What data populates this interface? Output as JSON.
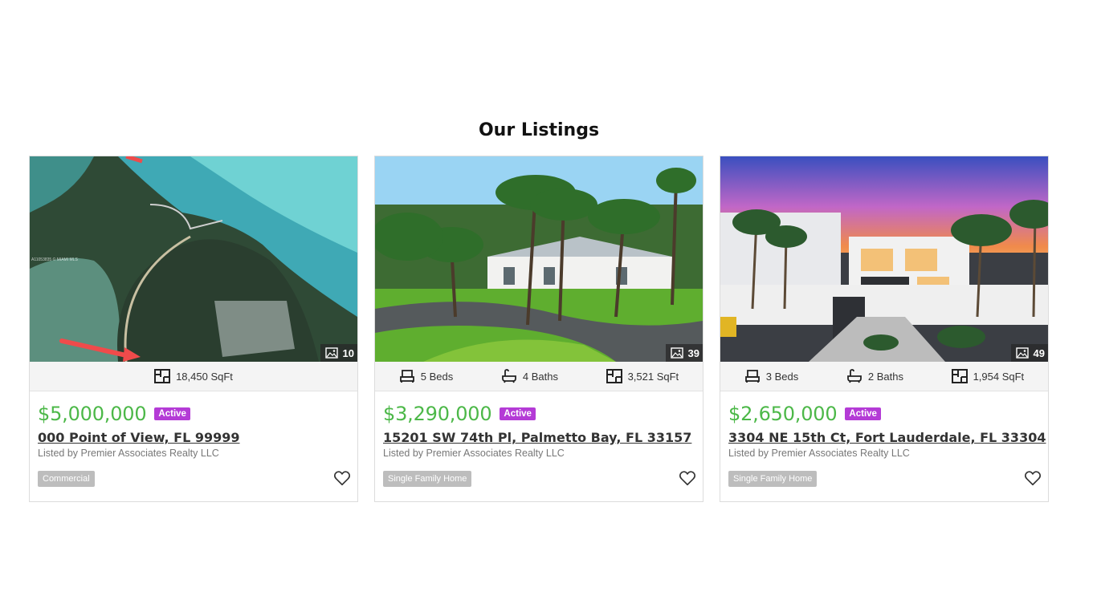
{
  "section": {
    "title": "Our Listings"
  },
  "listings": [
    {
      "photo_count": "10",
      "stats": {
        "sqft": "18,450 SqFt"
      },
      "price": "$5,000,000",
      "status": "Active",
      "address": "000 Point of View, FL 99999",
      "listed_by": "Listed by Premier Associates Realty LLC",
      "type": "Commercial",
      "image_watermark": "A11053835 © MIAMI MLS"
    },
    {
      "photo_count": "39",
      "stats": {
        "beds": "5 Beds",
        "baths": "4 Baths",
        "sqft": "3,521 SqFt"
      },
      "price": "$3,290,000",
      "status": "Active",
      "address": "15201 SW 74th Pl, Palmetto Bay, FL 33157",
      "listed_by": "Listed by Premier Associates Realty LLC",
      "type": "Single Family Home"
    },
    {
      "photo_count": "49",
      "stats": {
        "beds": "3 Beds",
        "baths": "2 Baths",
        "sqft": "1,954 SqFt"
      },
      "price": "$2,650,000",
      "status": "Active",
      "address": "3304 NE 15th Ct, Fort Lauderdale, FL 33304",
      "listed_by": "Listed by Premier Associates Realty LLC",
      "type": "Single Family Home"
    }
  ],
  "colors": {
    "price": "#4cb848",
    "status_badge": "#b43bd6",
    "type_tag": "#bdbdbd"
  },
  "icons": {
    "photo": "image-icon",
    "beds": "bed-icon",
    "baths": "bathtub-icon",
    "sqft": "floorplan-icon",
    "favorite": "heart-icon"
  }
}
